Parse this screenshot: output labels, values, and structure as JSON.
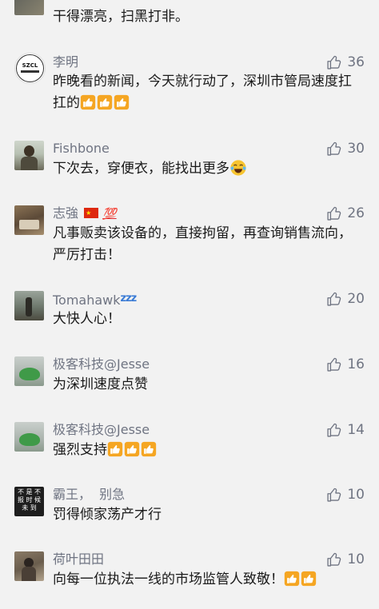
{
  "top_comment": {
    "text": "干得漂亮，扫黑打非。"
  },
  "comments": [
    {
      "name": "李明",
      "avatar_text": "SZCL",
      "likes": "36",
      "text": "昨晚看的新闻，今天就行动了，深圳市管局速度扛扛的",
      "thumbs": 3
    },
    {
      "name": "Fishbone",
      "likes": "30",
      "text": "下次去，穿便衣，能找出更多"
    },
    {
      "name": "志強",
      "likes": "26",
      "text": "凡事贩卖该设备的，直接拘留，再查询销售流向，严厉打击！",
      "badges": {
        "flag": "china-flag-emoji",
        "hundred": "💯"
      }
    },
    {
      "name": "Tomahawk",
      "name_suffix": "zzz",
      "likes": "20",
      "text": "大快人心！"
    },
    {
      "name": "极客科技@Jesse",
      "likes": "16",
      "text": "为深圳速度点赞"
    },
    {
      "name": "极客科技@Jesse",
      "likes": "14",
      "text": "强烈支持",
      "thumbs": 3
    },
    {
      "name": "霸王，  别急",
      "avatar_text": "不 是 不 报 时 候 未 到",
      "likes": "10",
      "text": "罚得倾家荡产才行"
    },
    {
      "name": "荷叶田田",
      "likes": "10",
      "text": "向每一位执法一线的市场监管人致敬！",
      "thumbs": 2
    }
  ],
  "icons": {
    "like": "thumbs-up-outline-icon",
    "emoji_thumb": "thumbs-up-emoji",
    "emoji_cry": "crying-laughing-emoji"
  },
  "colors": {
    "background": "#f2f2f2",
    "name": "#6f7482",
    "text": "#1a1a1a",
    "like": "#6f7482"
  }
}
